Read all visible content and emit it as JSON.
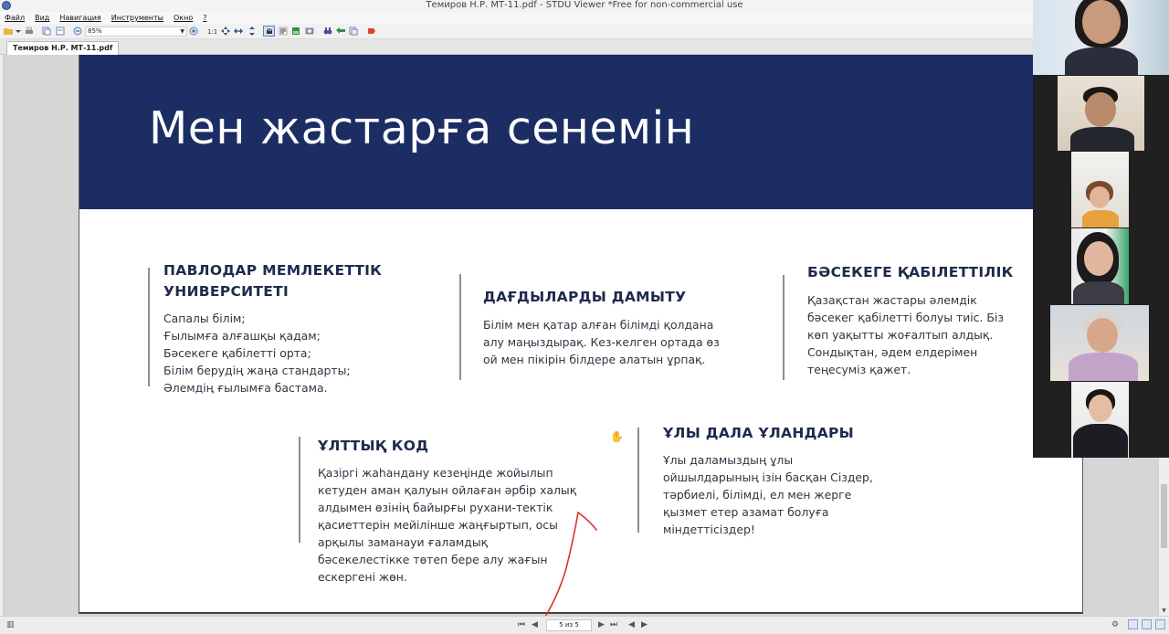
{
  "window": {
    "title": "Темиров Н.Р. МТ-11.pdf - STDU Viewer *Free for non-commercial use"
  },
  "menu": [
    "Файл",
    "Вид",
    "Навигация",
    "Инструменты",
    "Окно",
    "?"
  ],
  "toolbar": {
    "zoom_value": "85%",
    "icons": [
      "open-folder-icon",
      "print-icon",
      "copy-icon",
      "pages-icon",
      "zoom-out-icon",
      "zoom-in-icon",
      "actual-size-icon",
      "fit-page-icon",
      "fit-width-icon",
      "fit-height-icon",
      "hand-tool-icon",
      "select-text-icon",
      "select-image-icon",
      "snapshot-icon",
      "find-icon",
      "back-icon",
      "forward-icon",
      "bookmark-icon"
    ]
  },
  "tab": {
    "label": "Темиров Н.Р. МТ-11.pdf"
  },
  "slide": {
    "title": "Мен жастарға сенемін",
    "banner_color": "#1b2d63",
    "sections": [
      {
        "heading": "ПАВЛОДАР МЕМЛЕКЕТТІК\nУНИВЕРСИТЕТІ",
        "body": "Сапалы білім;\nҒылымға алғашқы қадам;\nБәсекеге қабілетті орта;\nБілім берудің жаңа стандарты;\nӘлемдің ғылымға бастама."
      },
      {
        "heading": "ДАҒДЫЛАРДЫ ДАМЫТУ",
        "body": "Білім мен қатар алған білімді қолдана\nалу маңыздырақ. Кез-келген ортада өз\nой мен пікірін білдере алатын ұрпақ."
      },
      {
        "heading": "БӘСЕКЕГЕ ҚАБІЛЕТТІЛІК",
        "body": "Қазақстан жастары әлемдік\nбәсекег қабілетті болуы тиіс. Біз\nкөп уақытты жоғалтып алдық.\nСондықтан, әдем елдерімен\nтеңесуміз қажет."
      },
      {
        "heading": "ҰЛТТЫҚ КОД",
        "body": "Қазіргі жаһандану кезеңінде жойылып\nкетуден аман қалуын ойлаған әрбір халық\nалдымен өзінің байырғы рухани-тектік\nқасиеттерін мейілінше жаңғыртып, осы\nарқылы заманауи ғаламдық\nбәсекелестікке төтеп бере алу жағын\nескергені жөн."
      },
      {
        "heading": "ҰЛЫ ДАЛА ҰЛАНДАРЫ",
        "body": "Ұлы даламыздың ұлы\nойшылдарының ізін басқан Сіздер,\nтәрбиелі, білімді, ел мен жерге\nқызмет етер азамат болуға\nміндеттісіздер!"
      }
    ]
  },
  "statusbar": {
    "page_indicator": "5 из 5"
  },
  "annotation_color": "#d8352a",
  "video_participants": [
    {
      "id": "p1"
    },
    {
      "id": "p2"
    },
    {
      "id": "p3"
    },
    {
      "id": "p4"
    },
    {
      "id": "p5"
    },
    {
      "id": "p6"
    }
  ]
}
